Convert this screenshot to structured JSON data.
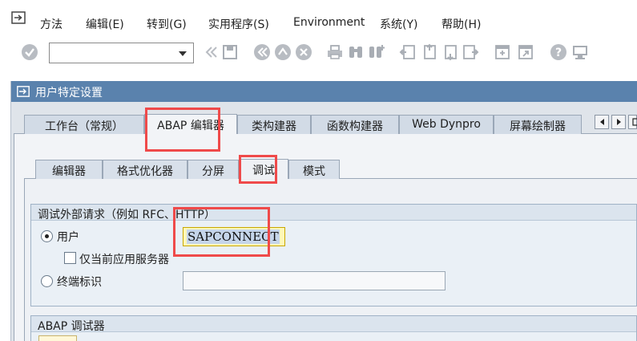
{
  "menubar": {
    "items": [
      "方法",
      "编辑(E)",
      "转到(G)",
      "实用程序(S)",
      "Environment",
      "系统(Y)",
      "帮助(H)"
    ]
  },
  "toolbar": {
    "command_field_value": "",
    "icons": [
      "enter-icon",
      "back-icon",
      "save-icon",
      "back-nav-icon",
      "exit-icon",
      "cancel-icon",
      "print-icon",
      "find-icon",
      "find-next-icon",
      "first-page-icon",
      "previous-page-icon",
      "next-page-icon",
      "last-page-icon",
      "create-session-icon",
      "shortcut-icon",
      "help-icon",
      "layout-icon"
    ]
  },
  "dialog": {
    "title": "用户特定设置"
  },
  "tabs": [
    "工作台（常规）",
    "ABAP 编辑器",
    "类构建器",
    "函数构建器",
    "Web Dynpro",
    "屏幕绘制器"
  ],
  "active_tab": "ABAP 编辑器",
  "subtabs": [
    "编辑器",
    "格式优化器",
    "分屏",
    "调试",
    "模式"
  ],
  "active_subtab": "调试",
  "group_external": {
    "title": "调试外部请求（例如 RFC、HTTP）",
    "option_user": "用户",
    "user_value": "SAPCONNECT",
    "checkbox_current_server": "仅当前应用服务器",
    "option_terminal": "终端标识",
    "terminal_value": ""
  },
  "group_debugger": {
    "title": "ABAP 调试器"
  },
  "colors": {
    "title_bar": "#5a82ad",
    "highlight": "#ef4a4a",
    "input_active": "#fff8b8"
  }
}
